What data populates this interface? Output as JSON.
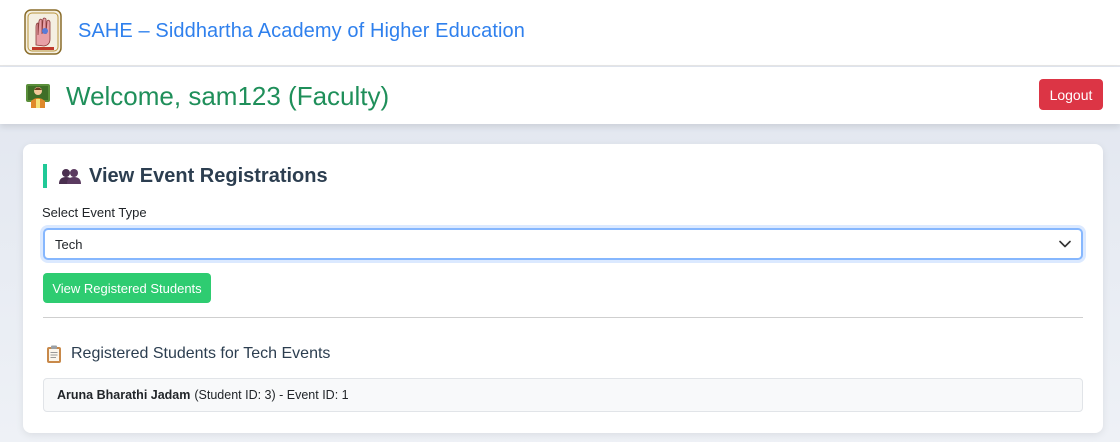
{
  "header": {
    "site_title": "SAHE – Siddhartha Academy of Higher Education"
  },
  "welcome": {
    "text": "Welcome, sam123 (Faculty)",
    "logout_label": "Logout"
  },
  "card": {
    "title": "View Event Registrations",
    "select_label": "Select Event Type",
    "select_value": "Tech",
    "view_button_label": "View Registered Students",
    "results_title": "Registered Students for Tech Events",
    "results": [
      {
        "name": "Aruna Bharathi Jadam",
        "details": "(Student ID: 3) - Event ID: 1"
      }
    ]
  },
  "colors": {
    "brand_blue": "#2f80ed",
    "welcome_green": "#1f8f5a",
    "logout_red": "#dc3545",
    "button_green": "#2ecc71",
    "accent_teal": "#20c997"
  },
  "icons": {
    "logo": "sahe-logo-icon",
    "teacher": "teacher-icon",
    "users": "users-icon",
    "clipboard": "clipboard-icon",
    "chevron": "chevron-down-icon"
  }
}
